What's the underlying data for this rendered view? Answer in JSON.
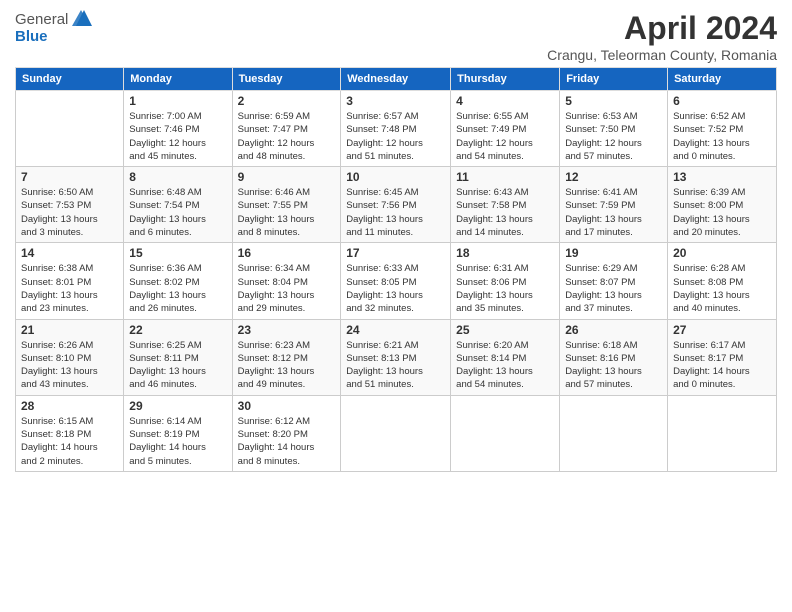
{
  "header": {
    "logo_general": "General",
    "logo_blue": "Blue",
    "month": "April 2024",
    "location": "Crangu, Teleorman County, Romania"
  },
  "weekdays": [
    "Sunday",
    "Monday",
    "Tuesday",
    "Wednesday",
    "Thursday",
    "Friday",
    "Saturday"
  ],
  "weeks": [
    [
      {
        "day": "",
        "info": ""
      },
      {
        "day": "1",
        "info": "Sunrise: 7:00 AM\nSunset: 7:46 PM\nDaylight: 12 hours\nand 45 minutes."
      },
      {
        "day": "2",
        "info": "Sunrise: 6:59 AM\nSunset: 7:47 PM\nDaylight: 12 hours\nand 48 minutes."
      },
      {
        "day": "3",
        "info": "Sunrise: 6:57 AM\nSunset: 7:48 PM\nDaylight: 12 hours\nand 51 minutes."
      },
      {
        "day": "4",
        "info": "Sunrise: 6:55 AM\nSunset: 7:49 PM\nDaylight: 12 hours\nand 54 minutes."
      },
      {
        "day": "5",
        "info": "Sunrise: 6:53 AM\nSunset: 7:50 PM\nDaylight: 12 hours\nand 57 minutes."
      },
      {
        "day": "6",
        "info": "Sunrise: 6:52 AM\nSunset: 7:52 PM\nDaylight: 13 hours\nand 0 minutes."
      }
    ],
    [
      {
        "day": "7",
        "info": "Sunrise: 6:50 AM\nSunset: 7:53 PM\nDaylight: 13 hours\nand 3 minutes."
      },
      {
        "day": "8",
        "info": "Sunrise: 6:48 AM\nSunset: 7:54 PM\nDaylight: 13 hours\nand 6 minutes."
      },
      {
        "day": "9",
        "info": "Sunrise: 6:46 AM\nSunset: 7:55 PM\nDaylight: 13 hours\nand 8 minutes."
      },
      {
        "day": "10",
        "info": "Sunrise: 6:45 AM\nSunset: 7:56 PM\nDaylight: 13 hours\nand 11 minutes."
      },
      {
        "day": "11",
        "info": "Sunrise: 6:43 AM\nSunset: 7:58 PM\nDaylight: 13 hours\nand 14 minutes."
      },
      {
        "day": "12",
        "info": "Sunrise: 6:41 AM\nSunset: 7:59 PM\nDaylight: 13 hours\nand 17 minutes."
      },
      {
        "day": "13",
        "info": "Sunrise: 6:39 AM\nSunset: 8:00 PM\nDaylight: 13 hours\nand 20 minutes."
      }
    ],
    [
      {
        "day": "14",
        "info": "Sunrise: 6:38 AM\nSunset: 8:01 PM\nDaylight: 13 hours\nand 23 minutes."
      },
      {
        "day": "15",
        "info": "Sunrise: 6:36 AM\nSunset: 8:02 PM\nDaylight: 13 hours\nand 26 minutes."
      },
      {
        "day": "16",
        "info": "Sunrise: 6:34 AM\nSunset: 8:04 PM\nDaylight: 13 hours\nand 29 minutes."
      },
      {
        "day": "17",
        "info": "Sunrise: 6:33 AM\nSunset: 8:05 PM\nDaylight: 13 hours\nand 32 minutes."
      },
      {
        "day": "18",
        "info": "Sunrise: 6:31 AM\nSunset: 8:06 PM\nDaylight: 13 hours\nand 35 minutes."
      },
      {
        "day": "19",
        "info": "Sunrise: 6:29 AM\nSunset: 8:07 PM\nDaylight: 13 hours\nand 37 minutes."
      },
      {
        "day": "20",
        "info": "Sunrise: 6:28 AM\nSunset: 8:08 PM\nDaylight: 13 hours\nand 40 minutes."
      }
    ],
    [
      {
        "day": "21",
        "info": "Sunrise: 6:26 AM\nSunset: 8:10 PM\nDaylight: 13 hours\nand 43 minutes."
      },
      {
        "day": "22",
        "info": "Sunrise: 6:25 AM\nSunset: 8:11 PM\nDaylight: 13 hours\nand 46 minutes."
      },
      {
        "day": "23",
        "info": "Sunrise: 6:23 AM\nSunset: 8:12 PM\nDaylight: 13 hours\nand 49 minutes."
      },
      {
        "day": "24",
        "info": "Sunrise: 6:21 AM\nSunset: 8:13 PM\nDaylight: 13 hours\nand 51 minutes."
      },
      {
        "day": "25",
        "info": "Sunrise: 6:20 AM\nSunset: 8:14 PM\nDaylight: 13 hours\nand 54 minutes."
      },
      {
        "day": "26",
        "info": "Sunrise: 6:18 AM\nSunset: 8:16 PM\nDaylight: 13 hours\nand 57 minutes."
      },
      {
        "day": "27",
        "info": "Sunrise: 6:17 AM\nSunset: 8:17 PM\nDaylight: 14 hours\nand 0 minutes."
      }
    ],
    [
      {
        "day": "28",
        "info": "Sunrise: 6:15 AM\nSunset: 8:18 PM\nDaylight: 14 hours\nand 2 minutes."
      },
      {
        "day": "29",
        "info": "Sunrise: 6:14 AM\nSunset: 8:19 PM\nDaylight: 14 hours\nand 5 minutes."
      },
      {
        "day": "30",
        "info": "Sunrise: 6:12 AM\nSunset: 8:20 PM\nDaylight: 14 hours\nand 8 minutes."
      },
      {
        "day": "",
        "info": ""
      },
      {
        "day": "",
        "info": ""
      },
      {
        "day": "",
        "info": ""
      },
      {
        "day": "",
        "info": ""
      }
    ]
  ]
}
